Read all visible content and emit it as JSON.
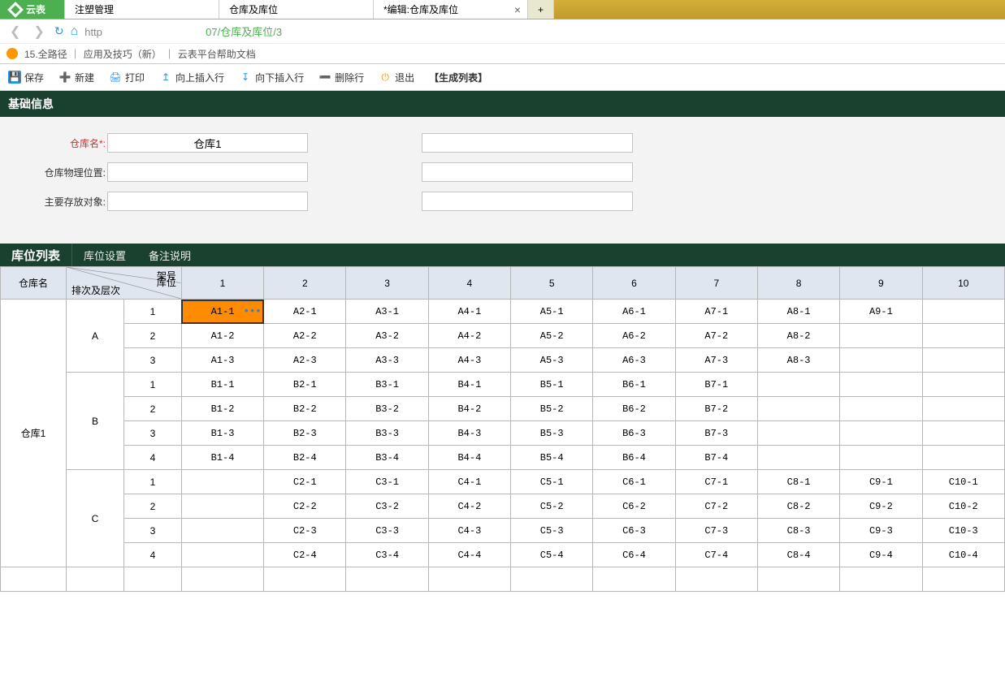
{
  "app": {
    "name": "云表"
  },
  "tabs": [
    {
      "label": "注塑管理"
    },
    {
      "label": "仓库及库位"
    },
    {
      "label": "*编辑:仓库及库位",
      "active": true,
      "closeable": true
    }
  ],
  "nav": {
    "url_prefix": "http",
    "url_highlight": "07/仓库及库位/3"
  },
  "breadcrumb": {
    "b1": "15.全路径",
    "b2": "应用及技巧（新）",
    "b3": "云表平台帮助文档"
  },
  "toolbar": {
    "save": "保存",
    "new": "新建",
    "print": "打印",
    "ins_up": "向上插入行",
    "ins_down": "向下插入行",
    "del_row": "删除行",
    "exit": "退出",
    "gen": "【生成列表】"
  },
  "section1": {
    "title": "基础信息"
  },
  "form": {
    "warehouse_label": "仓库名*:",
    "warehouse_value": "仓库1",
    "location_label": "仓库物理位置:",
    "location_value": "",
    "object_label": "主要存放对象:",
    "object_value": "",
    "r1_value": "",
    "r2_value": "",
    "r3_value": ""
  },
  "subtabs": {
    "t1": "库位列表",
    "t2": "库位设置",
    "t3": "备注说明"
  },
  "grid": {
    "diag": {
      "rack": "架号",
      "slot": "库位",
      "tier": "排次及层次"
    },
    "name_header": "仓库名",
    "cols": [
      "1",
      "2",
      "3",
      "4",
      "5",
      "6",
      "7",
      "8",
      "9",
      "10"
    ],
    "warehouse": "仓库1",
    "selected": {
      "section": "A",
      "row": "1",
      "col": "1"
    },
    "sections": [
      {
        "name": "A",
        "rows": [
          {
            "idx": "1",
            "cells": [
              "A1-1",
              "A2-1",
              "A3-1",
              "A4-1",
              "A5-1",
              "A6-1",
              "A7-1",
              "A8-1",
              "A9-1",
              ""
            ]
          },
          {
            "idx": "2",
            "cells": [
              "A1-2",
              "A2-2",
              "A3-2",
              "A4-2",
              "A5-2",
              "A6-2",
              "A7-2",
              "A8-2",
              "",
              ""
            ]
          },
          {
            "idx": "3",
            "cells": [
              "A1-3",
              "A2-3",
              "A3-3",
              "A4-3",
              "A5-3",
              "A6-3",
              "A7-3",
              "A8-3",
              "",
              ""
            ]
          }
        ]
      },
      {
        "name": "B",
        "rows": [
          {
            "idx": "1",
            "cells": [
              "B1-1",
              "B2-1",
              "B3-1",
              "B4-1",
              "B5-1",
              "B6-1",
              "B7-1",
              "",
              "",
              ""
            ]
          },
          {
            "idx": "2",
            "cells": [
              "B1-2",
              "B2-2",
              "B3-2",
              "B4-2",
              "B5-2",
              "B6-2",
              "B7-2",
              "",
              "",
              ""
            ]
          },
          {
            "idx": "3",
            "cells": [
              "B1-3",
              "B2-3",
              "B3-3",
              "B4-3",
              "B5-3",
              "B6-3",
              "B7-3",
              "",
              "",
              ""
            ]
          },
          {
            "idx": "4",
            "cells": [
              "B1-4",
              "B2-4",
              "B3-4",
              "B4-4",
              "B5-4",
              "B6-4",
              "B7-4",
              "",
              "",
              ""
            ]
          }
        ]
      },
      {
        "name": "C",
        "rows": [
          {
            "idx": "1",
            "cells": [
              "",
              "C2-1",
              "C3-1",
              "C4-1",
              "C5-1",
              "C6-1",
              "C7-1",
              "C8-1",
              "C9-1",
              "C10-1"
            ]
          },
          {
            "idx": "2",
            "cells": [
              "",
              "C2-2",
              "C3-2",
              "C4-2",
              "C5-2",
              "C6-2",
              "C7-2",
              "C8-2",
              "C9-2",
              "C10-2"
            ]
          },
          {
            "idx": "3",
            "cells": [
              "",
              "C2-3",
              "C3-3",
              "C4-3",
              "C5-3",
              "C6-3",
              "C7-3",
              "C8-3",
              "C9-3",
              "C10-3"
            ]
          },
          {
            "idx": "4",
            "cells": [
              "",
              "C2-4",
              "C3-4",
              "C4-4",
              "C5-4",
              "C6-4",
              "C7-4",
              "C8-4",
              "C9-4",
              "C10-4"
            ]
          }
        ]
      }
    ]
  }
}
